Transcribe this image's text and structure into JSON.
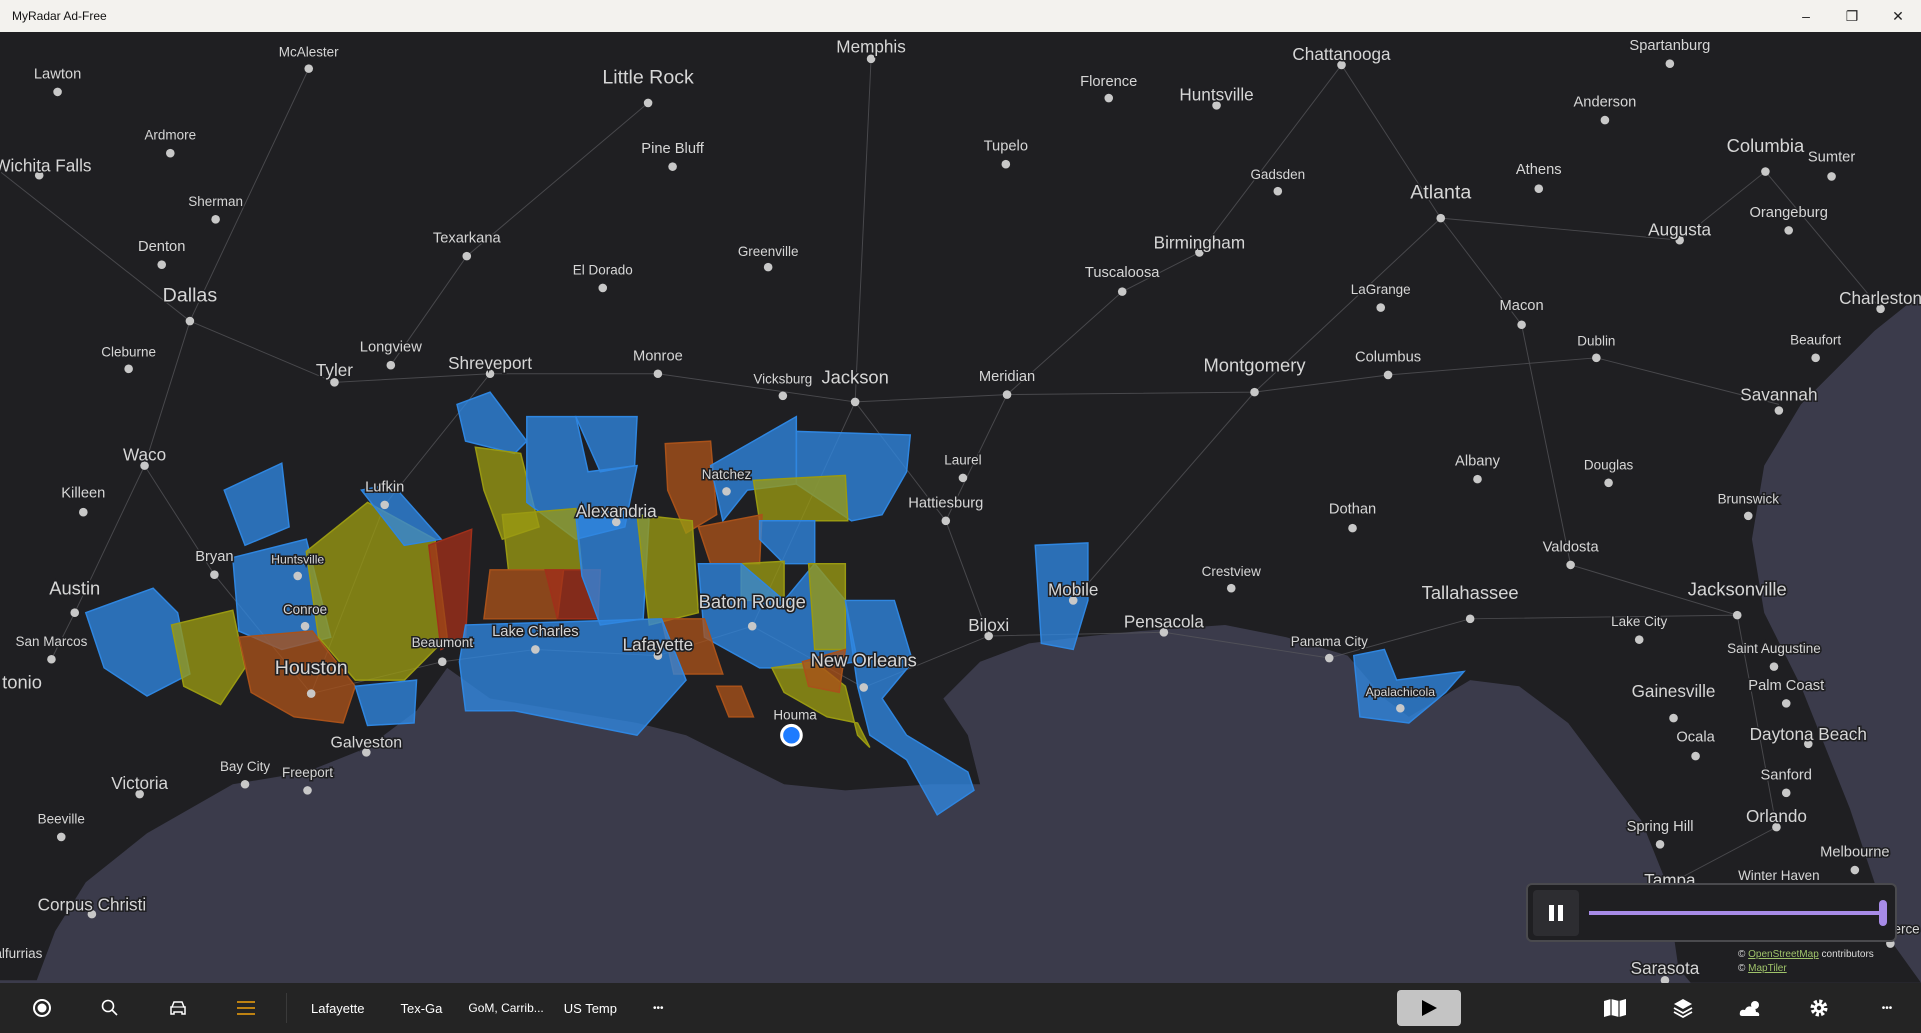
{
  "window": {
    "title": "MyRadar Ad-Free",
    "minimize_icon": "minimize-icon",
    "maximize_icon": "restore-icon",
    "close_icon": "close-icon"
  },
  "colors": {
    "land": "#1f1f22",
    "water": "#3b3b4b",
    "warning_blue": "#2f86e0",
    "warning_yellow": "#9a9a12",
    "warning_orange": "#a9521a",
    "warning_red": "#a0301a",
    "accent": "#a78be8",
    "menu_accent": "#f2a20c",
    "location": "#1e7bff"
  },
  "map": {
    "cities": [
      "McAlester",
      "Lawton",
      "Memphis",
      "Little Rock",
      "Chattanooga",
      "Spartanburg",
      "Florence",
      "Huntsville",
      "Anderson",
      "Ardmore",
      "Pine Bluff",
      "Tupelo",
      "Columbia",
      "Sumter",
      "Wichita Falls",
      "Athens",
      "Gadsden",
      "Atlanta",
      "Sherman",
      "Orangeburg",
      "Augusta",
      "Texarkana",
      "Birmingham",
      "Denton",
      "Greenville",
      "El Dorado",
      "Tuscaloosa",
      "LaGrange",
      "Dallas",
      "Charleston",
      "Macon",
      "Dublin",
      "Beaufort",
      "Longview",
      "Cleburne",
      "Monroe",
      "Columbus",
      "Shreveport",
      "Montgomery",
      "Tyler",
      "Vicksburg",
      "Jackson",
      "Meridian",
      "Savannah",
      "Waco",
      "Laurel",
      "Albany",
      "Douglas",
      "Natchez",
      "Lufkin",
      "Killeen",
      "Brunswick",
      "Hattiesburg",
      "Alexandria",
      "Dothan",
      "Valdosta",
      "Bryan",
      "Huntsville",
      "Crestview",
      "Mobile",
      "Austin",
      "Tallahassee",
      "Jacksonville",
      "Baton Rouge",
      "Conroe",
      "Pensacola",
      "Biloxi",
      "Lake City",
      "Lake Charles",
      "San Marcos",
      "Beaumont",
      "Panama City",
      "Lafayette",
      "Saint Augustine",
      "New Orleans",
      "Houston",
      "tonio",
      "Palm Coast",
      "Apalachicola",
      "Gainesville",
      "Houma",
      "Daytona Beach",
      "Ocala",
      "Galveston",
      "Bay City",
      "Freeport",
      "Sanford",
      "Victoria",
      "Orlando",
      "Beeville",
      "Spring Hill",
      "Melbourne",
      "Tampa",
      "Winter Haven",
      "Corpus Christi",
      "Sarasota",
      "alfurrias",
      "ierce"
    ],
    "user_location": "Houma"
  },
  "player": {
    "pause_icon": "pause-icon",
    "progress": 1.0
  },
  "attribution": {
    "line1_link": "OpenStreetMap",
    "line1_text": "contributors",
    "line2_link": "MapTiler",
    "copyright": "©"
  },
  "bottombar": {
    "icons": [
      "location-icon",
      "search-icon",
      "car-icon",
      "menu-icon"
    ],
    "favorites": [
      "Lafayette",
      "Tex-Ga",
      "GoM, Carrib...",
      "US Temp"
    ],
    "more": "•••",
    "right_icons": [
      "map-icon",
      "layers-icon",
      "weather-icon",
      "settings-icon",
      "more-icon"
    ]
  }
}
